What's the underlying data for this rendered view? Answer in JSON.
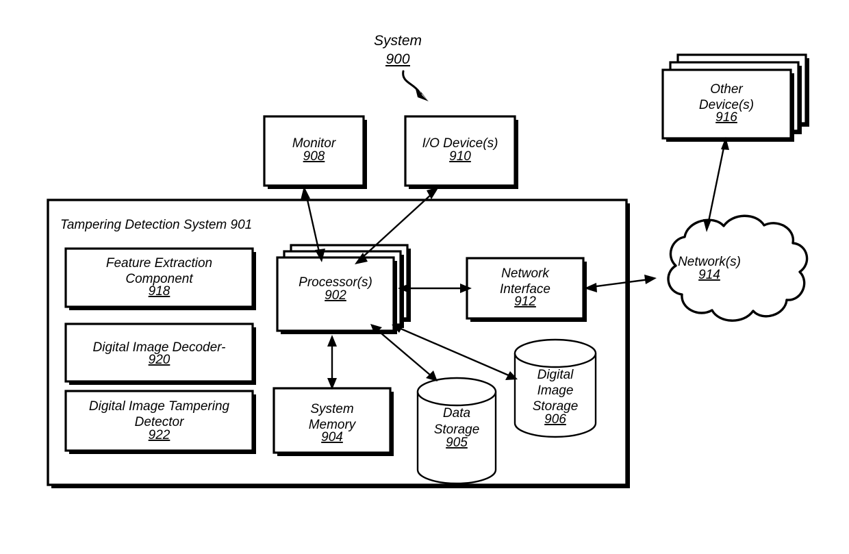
{
  "figure": {
    "title": "System",
    "title_number": "900",
    "container": {
      "label": "Tampering Detection System 901",
      "name": "Tampering Detection System",
      "number": "901"
    }
  },
  "nodes": {
    "monitor": {
      "line1": "Monitor",
      "number": "908"
    },
    "io_devices": {
      "line1": "I/O Device(s)",
      "number": "910"
    },
    "processors": {
      "line1": "Processor(s)",
      "number": "902"
    },
    "network_interface": {
      "line1": "Network",
      "line2": "Interface",
      "number": "912"
    },
    "networks": {
      "line1": "Network(s)",
      "number": "914"
    },
    "other_devices": {
      "line1": "Other",
      "line2": "Device(s)",
      "number": "916"
    },
    "feature_extraction": {
      "line1": "Feature Extraction",
      "line2": "Component",
      "number": "918"
    },
    "image_decoder": {
      "line1": "Digital Image Decoder-",
      "number": "920"
    },
    "tampering_detector": {
      "line1": "Digital Image Tampering",
      "line2": "Detector",
      "number": "922"
    },
    "system_memory": {
      "line1": "System",
      "line2": "Memory",
      "number": "904"
    },
    "data_storage": {
      "line1": "Data",
      "line2": "Storage",
      "number": "905"
    },
    "digital_image_storage": {
      "line1": "Digital",
      "line2": "Image",
      "line3": "Storage",
      "number": "906"
    }
  },
  "colors": {
    "stroke": "#000000",
    "fill": "#ffffff",
    "background": "#ffffff"
  }
}
